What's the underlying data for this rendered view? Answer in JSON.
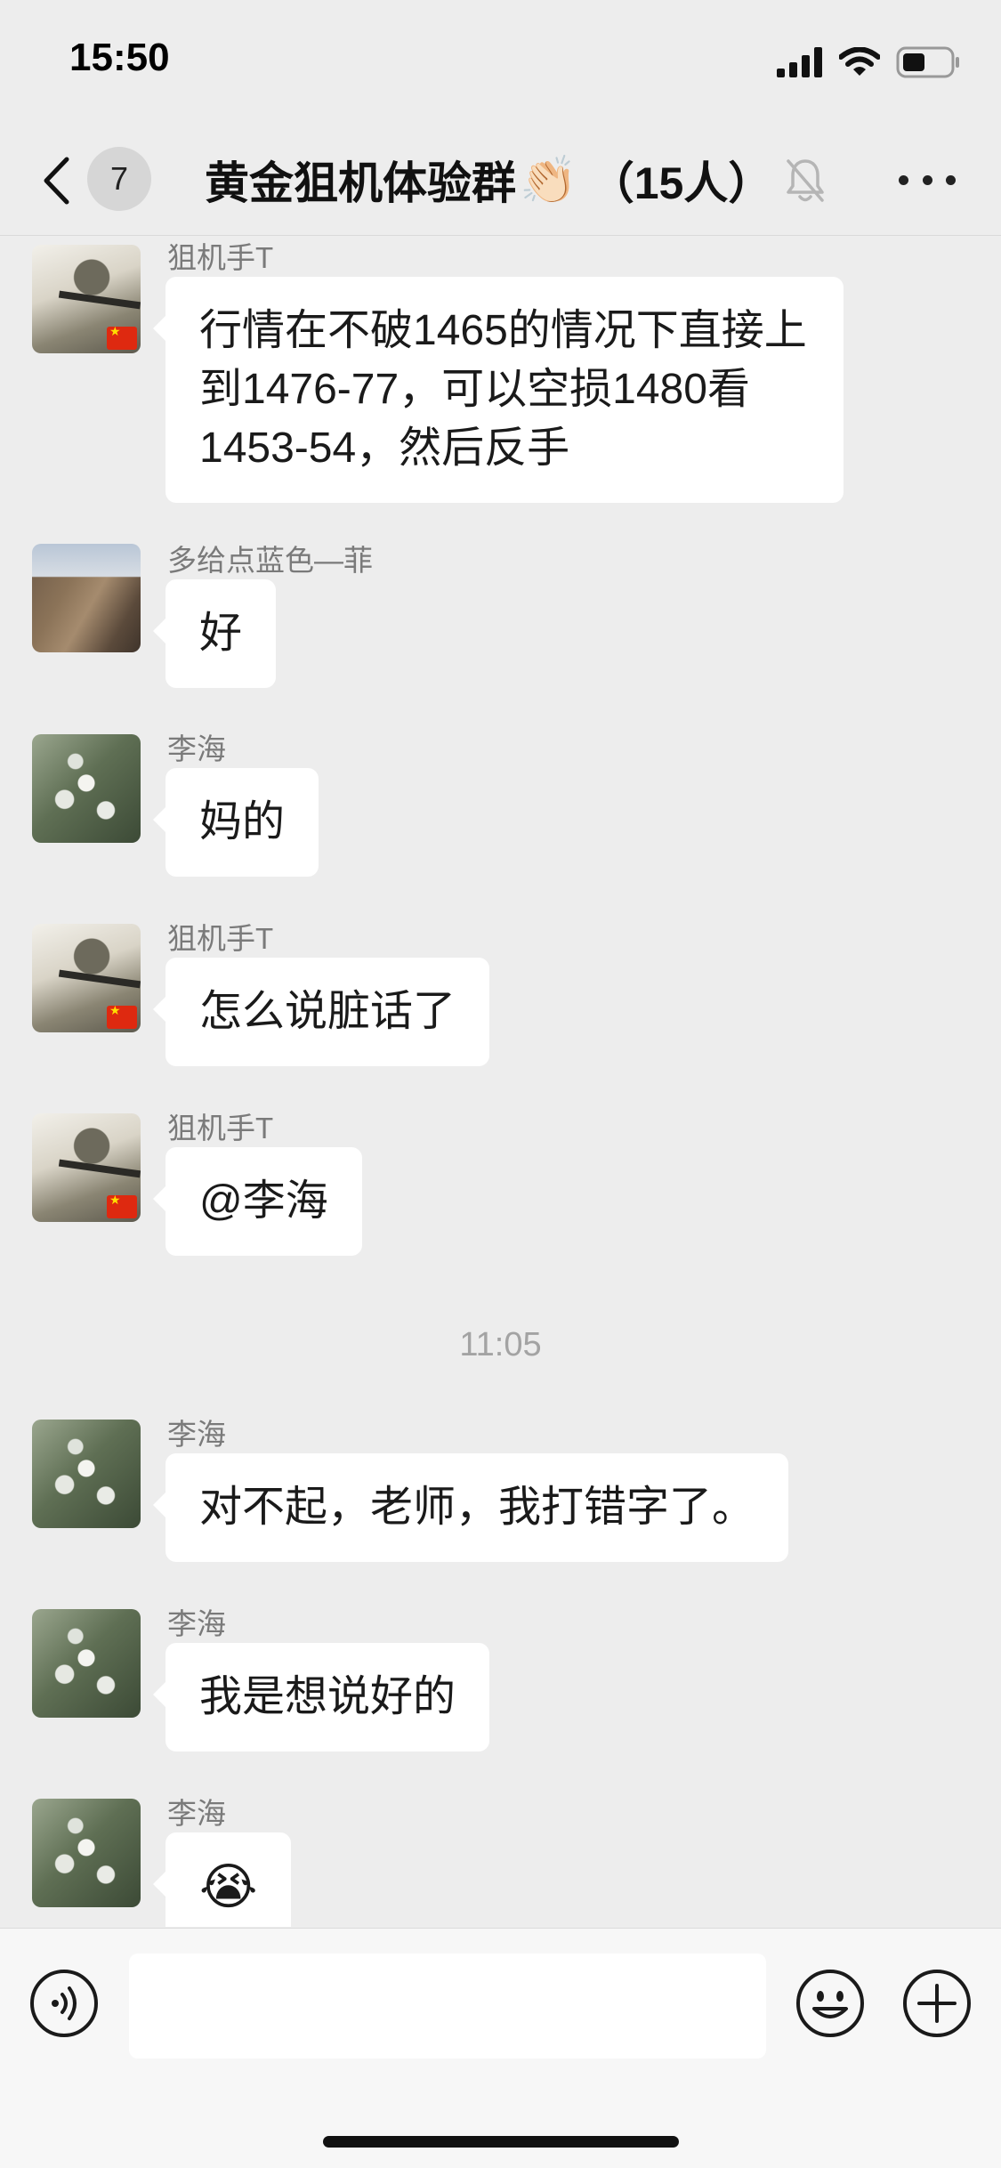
{
  "status_bar": {
    "time": "15:50",
    "icons": [
      "signal-icon",
      "wifi-icon",
      "battery-icon"
    ]
  },
  "nav": {
    "back_icon": "chevron-left-icon",
    "unread_count": "7",
    "title": "黄金狙机体验群",
    "title_emoji": "👏🏻",
    "member_count": "（15人）",
    "mute_icon": "bell-slash-icon",
    "more_icon": "more-dots-icon"
  },
  "messages": [
    {
      "sender": "狙机手T",
      "avatar": "sniper-avatar",
      "text": "行情在不破1465的情况下直接上到1476-77，可以空损1480看1453-54，然后反手"
    },
    {
      "sender": "多给点蓝色—菲",
      "avatar": "mountain-avatar",
      "text": "好"
    },
    {
      "sender": "李海",
      "avatar": "flower-avatar",
      "text": "妈的"
    },
    {
      "sender": "狙机手T",
      "avatar": "sniper-avatar",
      "text": "怎么说脏话了"
    },
    {
      "sender": "狙机手T",
      "avatar": "sniper-avatar",
      "text": "@李海"
    },
    {
      "time_separator": "11:05"
    },
    {
      "sender": "李海",
      "avatar": "flower-avatar",
      "text": "对不起，老师，我打错字了。"
    },
    {
      "sender": "李海",
      "avatar": "flower-avatar",
      "text": "我是想说好的"
    },
    {
      "sender": "李海",
      "avatar": "flower-avatar",
      "emoji": "😭",
      "emoji_name": "laughing-crying-emoji"
    }
  ],
  "input_bar": {
    "voice_icon": "voice-icon",
    "text_value": "",
    "emoji_icon": "smiley-icon",
    "plus_icon": "plus-circle-icon"
  },
  "colors": {
    "background": "#ededed",
    "bubble": "#ffffff",
    "sender_text": "#7a7a7a",
    "timestamp_text": "#a3a3a3",
    "input_bar": "#f7f7f7"
  }
}
